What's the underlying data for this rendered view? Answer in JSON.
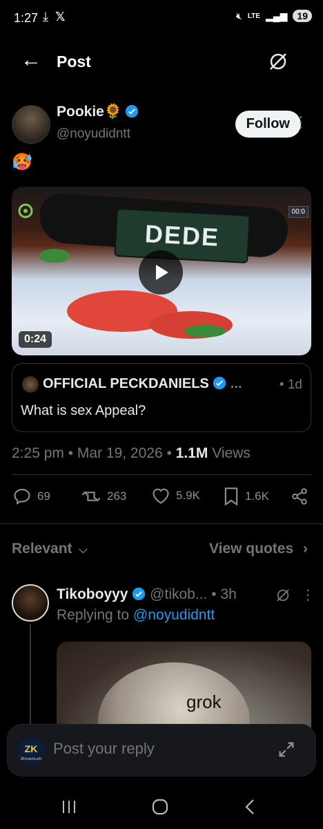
{
  "status_bar": {
    "time": "1:27",
    "network": "LTE",
    "battery": "19"
  },
  "header": {
    "title": "Post"
  },
  "post": {
    "author_name": "Pookie🌻",
    "author_handle": "@noyudidntt",
    "follow_label": "Follow",
    "text": "🥵",
    "video_overlay_text": "DEDE",
    "video_duration": "0:24",
    "video_channel_overlay": "00:0",
    "quoted": {
      "author_name": "OFFICIAL PECKDANIELS",
      "ellipsis": "...",
      "time": "• 1d",
      "text": "What is sex Appeal?"
    },
    "timestamp": "2:25 pm • Mar 19, 2026 • ",
    "views_count": "1.1M",
    "views_label": " Views",
    "actions": {
      "replies": "69",
      "reposts": "263",
      "likes": "5.9K",
      "bookmarks": "1.6K"
    }
  },
  "replies_header": {
    "sort_label": "Relevant",
    "view_quotes_label": "View quotes"
  },
  "reply": {
    "author_name": "Tikoboyyy",
    "author_handle": "@tikob...",
    "time": "• 3h",
    "replying_prefix": "Replying to ",
    "replying_handle": "@noyudidntt",
    "image_text": "grok"
  },
  "composer": {
    "avatar_text": "ZK",
    "avatar_subtext": "ZKoracle.eth",
    "placeholder": "Post your reply"
  },
  "colors": {
    "background": "#000000",
    "text_primary": "#e7e9ea",
    "text_secondary": "#71767b",
    "accent": "#1d9bf0",
    "border": "#2f3336"
  }
}
